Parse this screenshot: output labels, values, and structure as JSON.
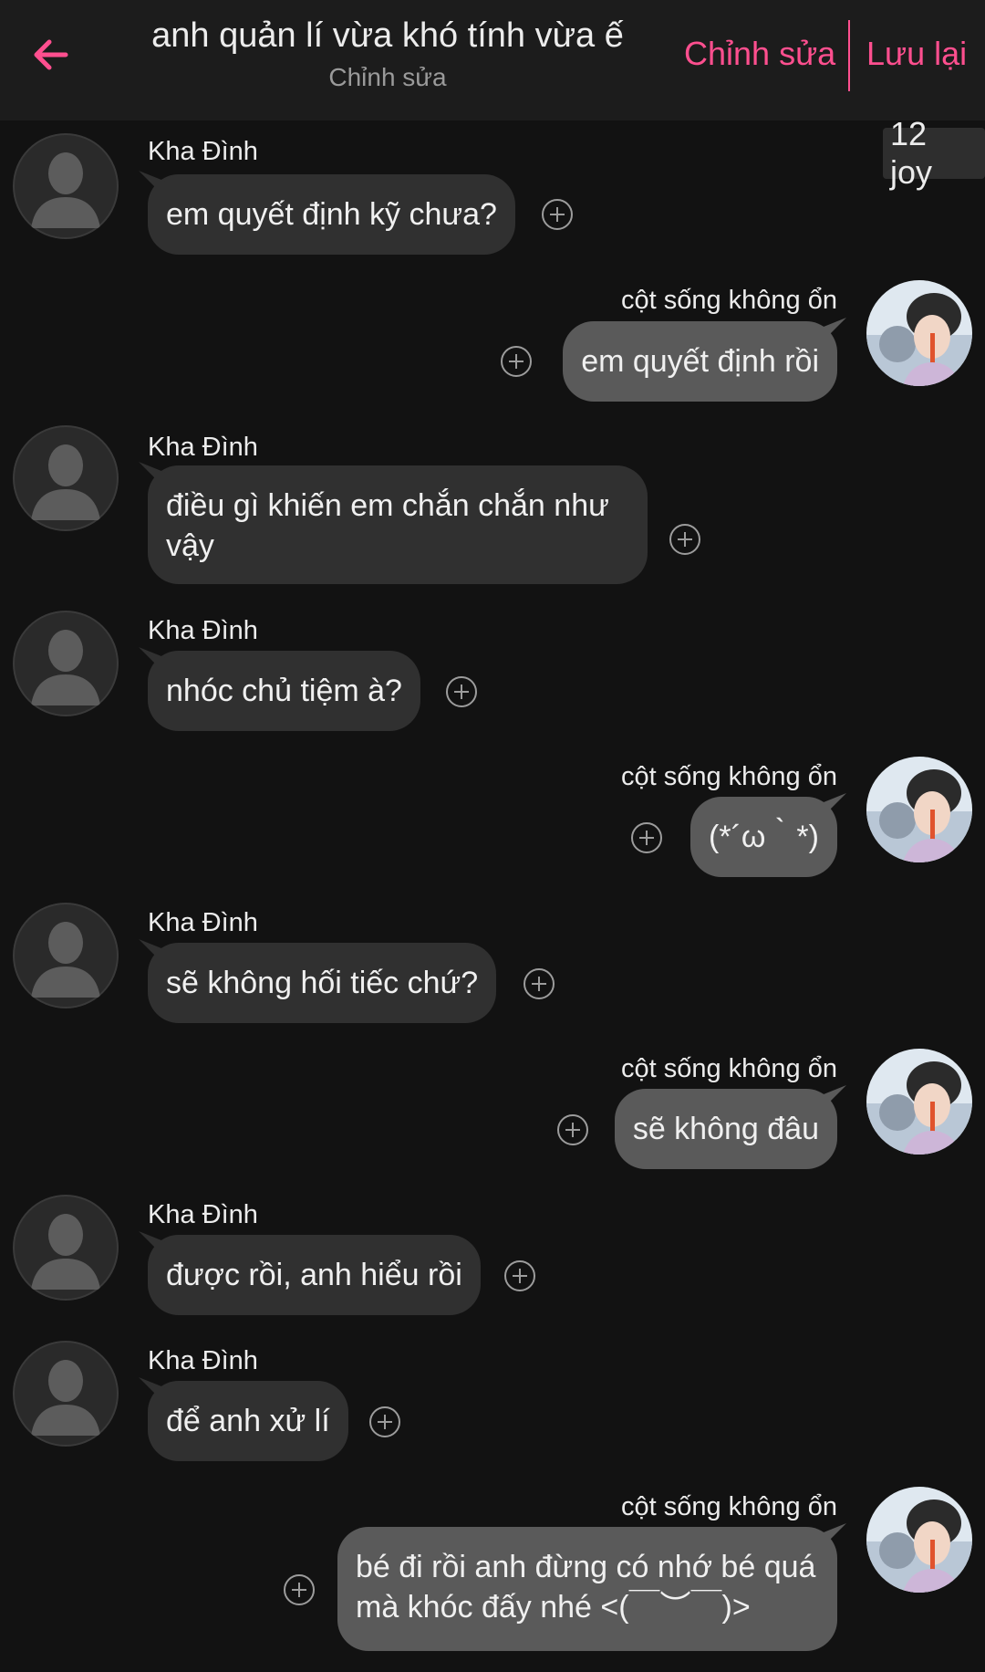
{
  "header": {
    "title": "anh quản lí vừa khó tính vừa ế",
    "subtitle": "Chỉnh sửa",
    "edit_label": "Chỉnh sửa",
    "save_label": "Lưu lại",
    "accent_color": "#ff4f8f"
  },
  "joy_badge": "12 joy",
  "messages": [
    {
      "sender": "Kha Đình",
      "text": "em quyết định kỹ chưa?",
      "side": "other"
    },
    {
      "sender": "cột sống không ổn",
      "text": "em quyết định rồi",
      "side": "me"
    },
    {
      "sender": "Kha Đình",
      "text": "điều gì khiến em chắn chắn như vậy",
      "side": "other"
    },
    {
      "sender": "Kha Đình",
      "text": "nhóc chủ tiệm à?",
      "side": "other"
    },
    {
      "sender": "cột sống không ổn",
      "text": "(*´ω｀*)",
      "side": "me"
    },
    {
      "sender": "Kha Đình",
      "text": "sẽ không hối tiếc chứ?",
      "side": "other"
    },
    {
      "sender": "cột sống không ổn",
      "text": "sẽ không đâu",
      "side": "me"
    },
    {
      "sender": "Kha Đình",
      "text": "được rồi, anh hiểu rồi",
      "side": "other"
    },
    {
      "sender": "Kha Đình",
      "text": "để anh xử lí",
      "side": "other"
    },
    {
      "sender": "cột sống không ổn",
      "text": "bé đi rồi anh đừng có nhớ bé quá mà khóc đấy nhé <(￣︶￣)>",
      "side": "me"
    }
  ]
}
